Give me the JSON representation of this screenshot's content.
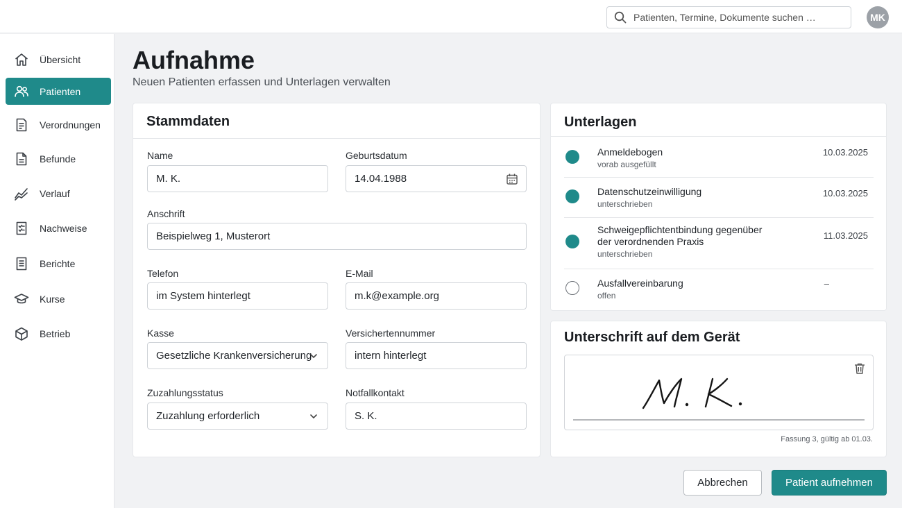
{
  "search": {
    "placeholder": "Patienten, Termine, Dokumente suchen …"
  },
  "user": {
    "initials": "MK"
  },
  "colors": {
    "accent": "#1f8a8a",
    "background": "#f1f2f4"
  },
  "sidebar": {
    "items": [
      {
        "label": "Übersicht",
        "icon": "home-icon"
      },
      {
        "label": "Patienten",
        "icon": "users-icon",
        "active": true
      },
      {
        "label": "Verordnungen",
        "icon": "prescription-icon"
      },
      {
        "label": "Befunde",
        "icon": "document-icon"
      },
      {
        "label": "Verlauf",
        "icon": "trend-icon"
      },
      {
        "label": "Nachweise",
        "icon": "checklist-icon"
      },
      {
        "label": "Berichte",
        "icon": "report-icon"
      },
      {
        "label": "Kurse",
        "icon": "graduation-cap-icon"
      },
      {
        "label": "Betrieb",
        "icon": "box-icon"
      }
    ]
  },
  "header": {
    "title": "Aufnahme",
    "subtitle": "Neuen Patienten erfassen und Unterlagen verwalten"
  },
  "stammdaten": {
    "title": "Stammdaten",
    "name": {
      "label": "Name",
      "value": "M. K."
    },
    "geburtsdatum": {
      "label": "Geburtsdatum",
      "value": "14.04.1988"
    },
    "anschrift": {
      "label": "Anschrift",
      "value": "Beispielweg 1, Musterort"
    },
    "telefon": {
      "label": "Telefon",
      "value": "im System hinterlegt"
    },
    "email": {
      "label": "E-Mail",
      "value": "m.k@example.org"
    },
    "kasse": {
      "label": "Kasse",
      "value": "Gesetzliche Krankenversicherung"
    },
    "versichertennummer": {
      "label": "Versichertennummer",
      "value": "intern hinterlegt"
    },
    "zuzahlungsstatus": {
      "label": "Zuzahlungsstatus",
      "value": "Zuzahlung erforderlich"
    },
    "notfallkontakt": {
      "label": "Notfallkontakt",
      "value": "S. K."
    }
  },
  "unterlagen": {
    "title": "Unterlagen",
    "items": [
      {
        "name": "Anmeldebogen",
        "status": "vorab ausgefüllt",
        "date": "10.03.2025",
        "done": true
      },
      {
        "name": "Datenschutzeinwilligung",
        "status": "unterschrieben",
        "date": "10.03.2025",
        "done": true
      },
      {
        "name_line1": "Schweigepflichtentbindung gegenüber",
        "name_line2": "der verordnenden Praxis",
        "status": "unterschrieben",
        "date": "11.03.2025",
        "done": true
      },
      {
        "name": "Ausfallvereinbarung",
        "status": "offen",
        "date": "–",
        "done": false
      }
    ]
  },
  "signature": {
    "title": "Unterschrift auf dem Gerät",
    "footnote": "Fassung 3, gültig ab 01.03."
  },
  "actions": {
    "cancel": "Abbrechen",
    "submit": "Patient aufnehmen"
  }
}
